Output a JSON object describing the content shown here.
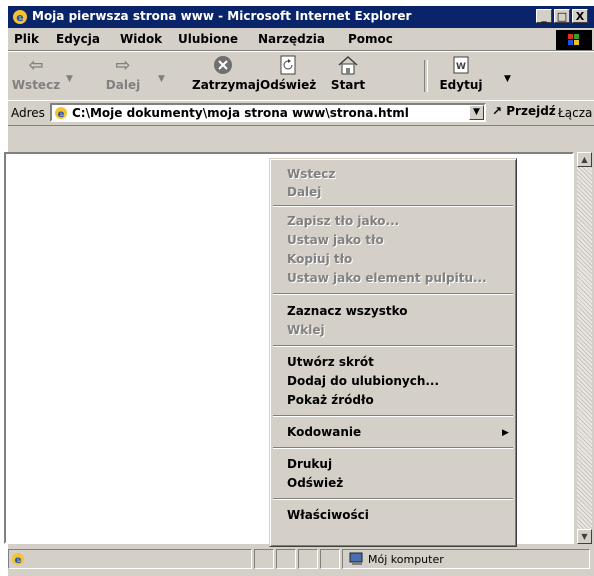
{
  "window": {
    "title": "Moja pierwsza strona www - Microsoft Internet Explorer",
    "controls": [
      "_",
      "□",
      "X"
    ]
  },
  "menubar": [
    "Plik",
    "Edycja",
    "Widok",
    "Ulubione",
    "Narzędzia",
    "Pomoc"
  ],
  "toolbar": {
    "back": "Wstecz",
    "forward": "Dalej",
    "stop": "Zatrzymaj",
    "refresh": "Odśwież",
    "home": "Start",
    "edit": "Edytuj"
  },
  "address": {
    "label": "Adres",
    "value": "C:\\Moje dokumenty\\moja strona www\\strona.html",
    "go": "Przejdź",
    "links": "Łącza"
  },
  "status": {
    "zone": "Mój komputer"
  },
  "context_menu": {
    "items": [
      {
        "label": "Wstecz",
        "enabled": false
      },
      {
        "label": "Dalej",
        "enabled": false
      },
      {
        "label": "Zapisz tło jako...",
        "enabled": false
      },
      {
        "label": "Ustaw jako tło",
        "enabled": false
      },
      {
        "label": "Kopiuj tło",
        "enabled": false
      },
      {
        "label": "Ustaw jako element pulpitu...",
        "enabled": false
      },
      {
        "label": "Zaznacz wszystko",
        "enabled": true
      },
      {
        "label": "Wklej",
        "enabled": false
      },
      {
        "label": "Utwórz skrót",
        "enabled": true
      },
      {
        "label": "Dodaj do ulubionych...",
        "enabled": true
      },
      {
        "label": "Pokaż źródło",
        "enabled": true
      },
      {
        "label": "Kodowanie",
        "enabled": true,
        "submenu": true
      },
      {
        "label": "Drukuj",
        "enabled": true
      },
      {
        "label": "Odśwież",
        "enabled": true
      },
      {
        "label": "Właściwości",
        "enabled": true
      }
    ]
  }
}
